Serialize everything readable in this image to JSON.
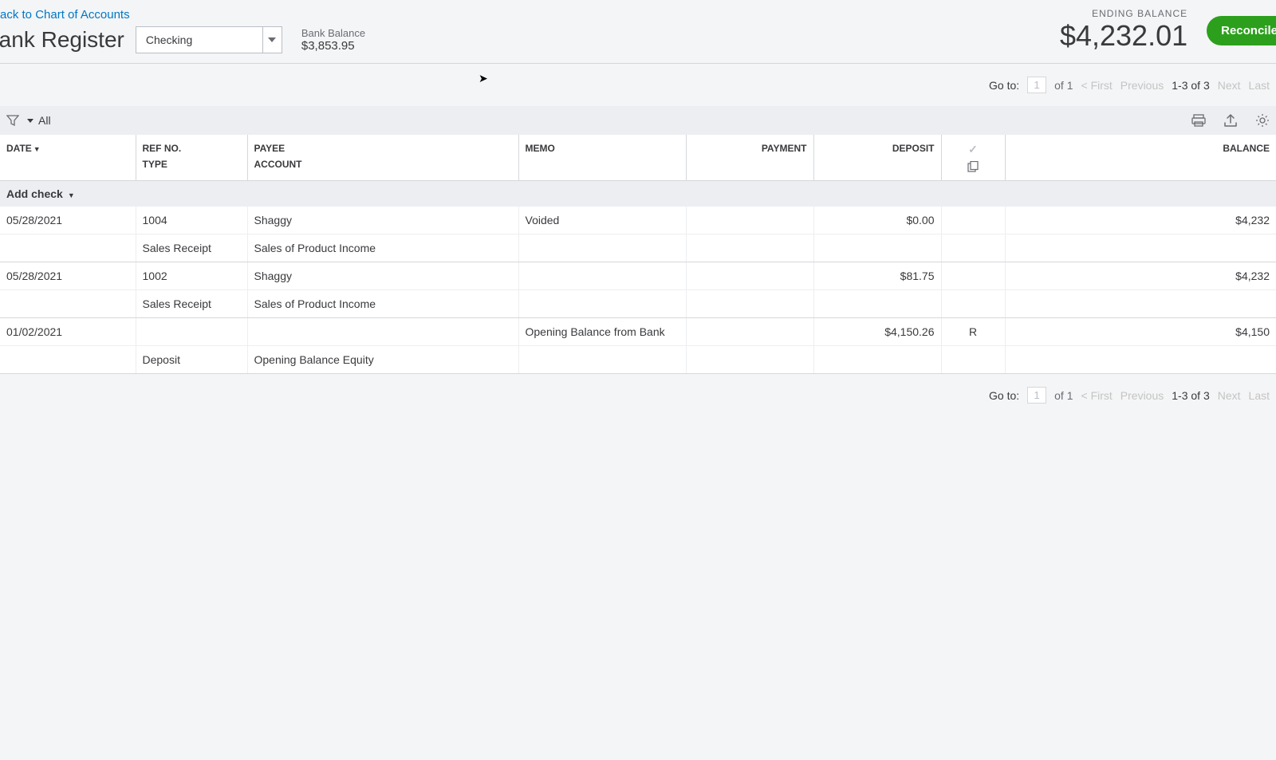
{
  "header": {
    "back_link": "Back to Chart of Accounts",
    "title": "Bank Register",
    "account_selected": "Checking",
    "bank_balance_label": "Bank Balance",
    "bank_balance_amount": "$3,853.95",
    "ending_balance_label": "ENDING BALANCE",
    "ending_balance_amount": "$4,232.01",
    "reconcile_button": "Reconcile"
  },
  "pagination": {
    "goto_label": "Go to:",
    "page_input": "1",
    "of_label": "of 1",
    "first": "< First",
    "previous": "Previous",
    "range": "1-3 of 3",
    "next": "Next",
    "last": "Last"
  },
  "filter": {
    "label": "All"
  },
  "columns": {
    "date": "DATE",
    "ref": "REF NO.",
    "type": "TYPE",
    "payee": "PAYEE",
    "account": "ACCOUNT",
    "memo": "MEMO",
    "payment": "PAYMENT",
    "deposit": "DEPOSIT",
    "balance": "BALANCE"
  },
  "add_row": "Add check",
  "rows": [
    {
      "date": "05/28/2021",
      "ref": "1004",
      "payee": "Shaggy",
      "memo": "Voided",
      "payment": "",
      "deposit": "$0.00",
      "reconciled": "",
      "balance": "$4,232",
      "type": "Sales Receipt",
      "account": "Sales of Product Income"
    },
    {
      "date": "05/28/2021",
      "ref": "1002",
      "payee": "Shaggy",
      "memo": "",
      "payment": "",
      "deposit": "$81.75",
      "reconciled": "",
      "balance": "$4,232",
      "type": "Sales Receipt",
      "account": "Sales of Product Income"
    },
    {
      "date": "01/02/2021",
      "ref": "",
      "payee": "",
      "memo": "Opening Balance from Bank",
      "payment": "",
      "deposit": "$4,150.26",
      "reconciled": "R",
      "balance": "$4,150",
      "type": "Deposit",
      "account": "Opening Balance Equity"
    }
  ]
}
